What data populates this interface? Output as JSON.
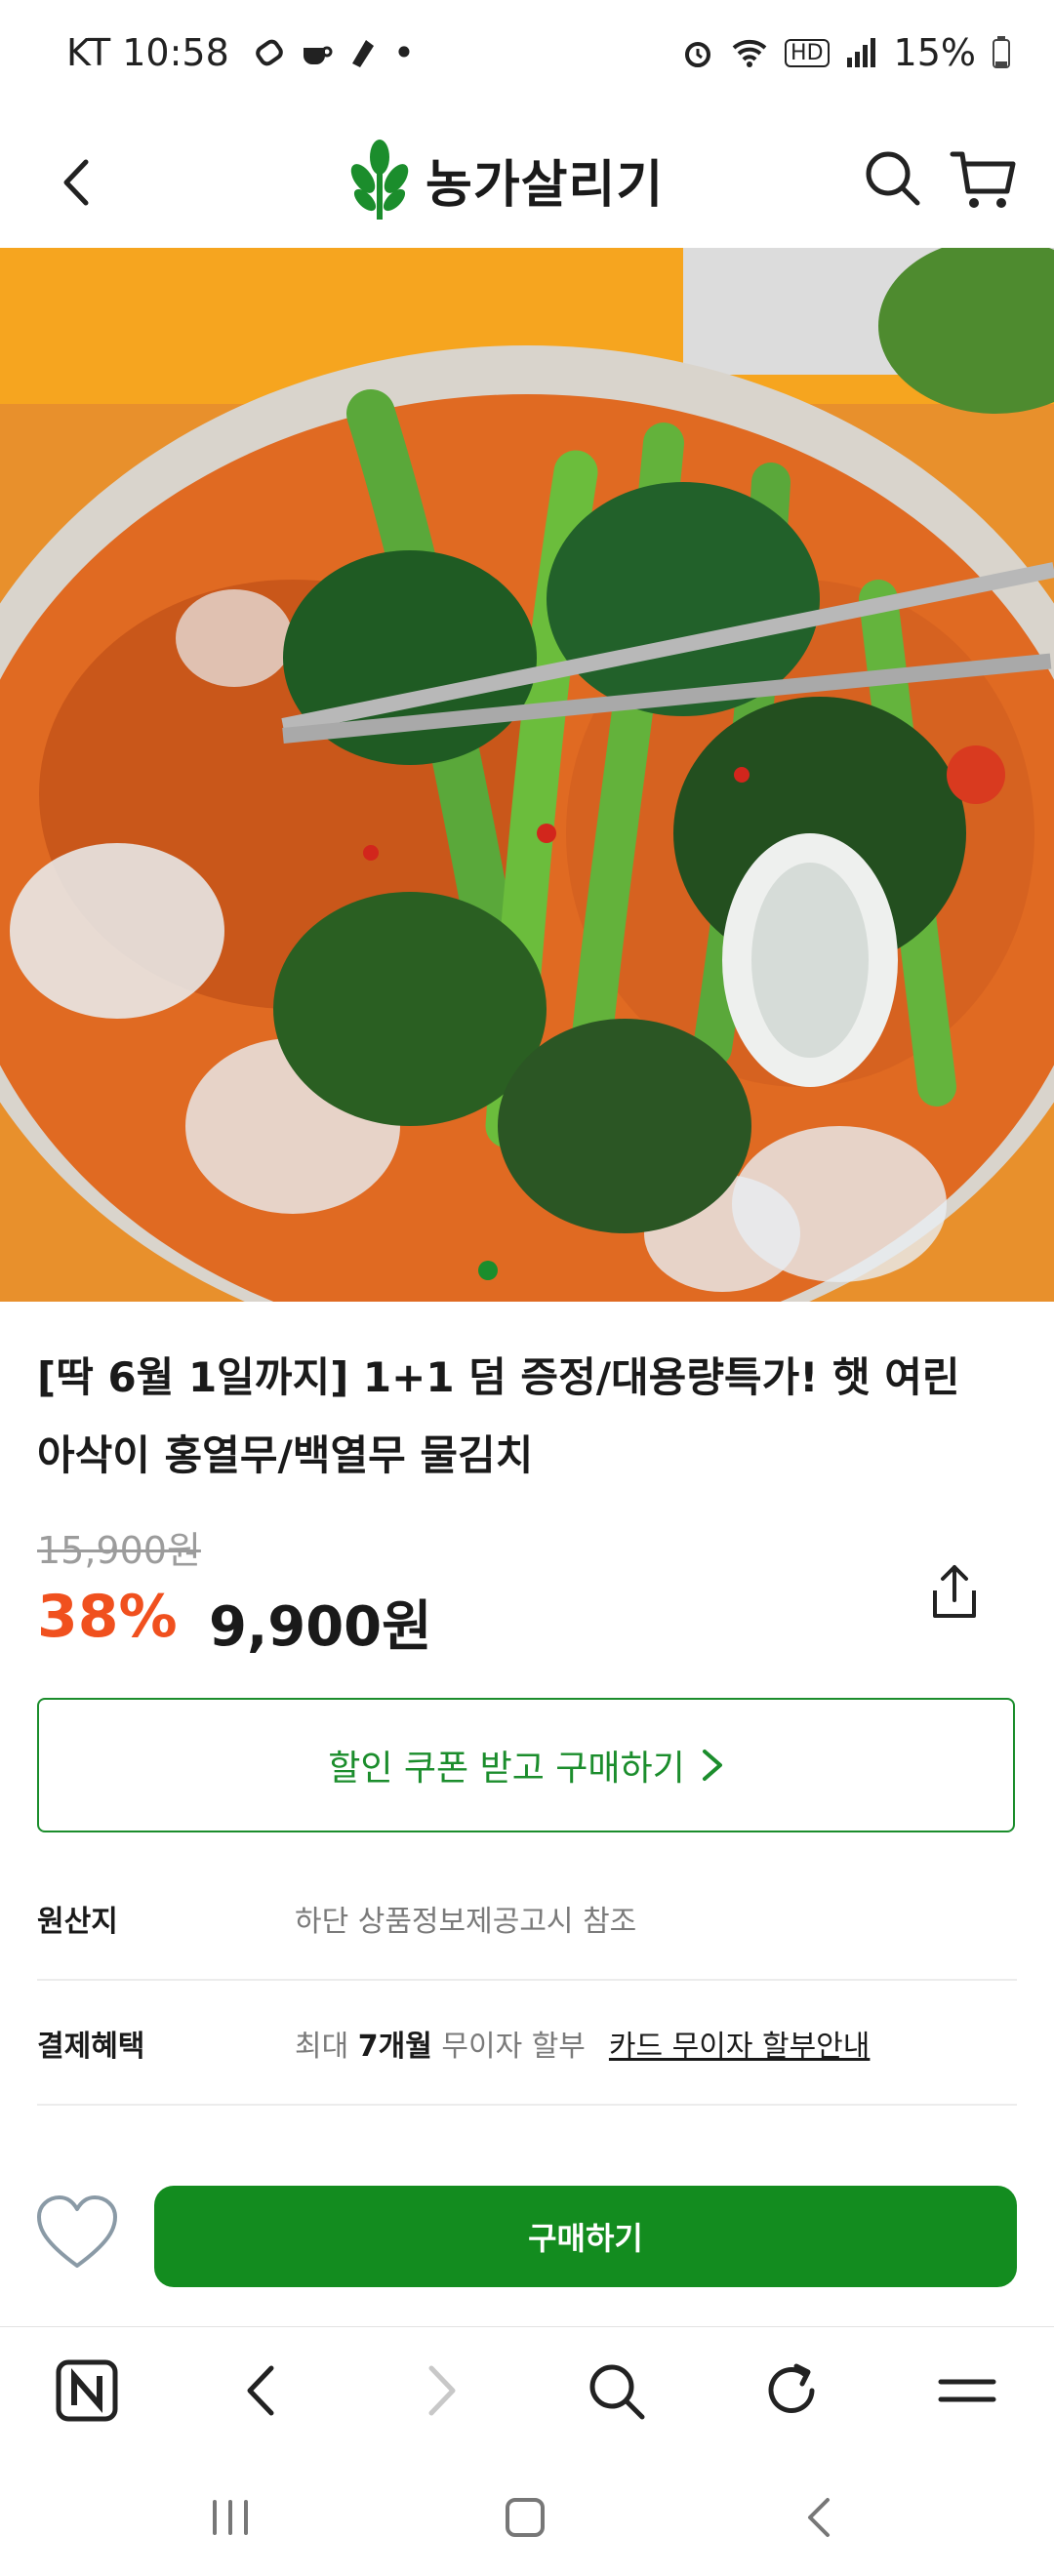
{
  "status_bar": {
    "carrier_time": "KT 10:58",
    "dot": "•",
    "hd_label": "HD",
    "battery": "15%",
    "icons": [
      "phone-link-icon",
      "coffee-icon",
      "note-icon",
      "alarm-icon",
      "wifi-icon",
      "hd-icon",
      "signal-icon",
      "battery-icon"
    ]
  },
  "header": {
    "brand_name": "농가살리기",
    "back_icon": "back-arrow-icon",
    "search_icon": "search-icon",
    "cart_icon": "cart-icon",
    "brand_color": "#1b8d2c"
  },
  "hero": {
    "carousel_dots": 1,
    "active_dot_color": "#1b8d2c"
  },
  "product": {
    "title_line1": "[딱 6월 1일까지] 1+1 덤 증정/대용량특가! 햇 여린",
    "title_line2": "아삭이 홍열무/백열무 물김치",
    "original_price": "15,900원",
    "discount": "38%",
    "price": "9,900원",
    "discount_color": "#f0501e",
    "share_icon": "share-icon"
  },
  "coupon": {
    "label": "할인 쿠폰 받고 구매하기",
    "chevron": "›"
  },
  "info": {
    "origin_label": "원산지",
    "origin_value": "하단 상품정보제공고시 참조",
    "payment_label": "결제혜택",
    "payment_prefix": "최대 ",
    "payment_bold": "7개월",
    "payment_suffix": " 무이자 할부",
    "payment_link": "카드 무이자 할부안내"
  },
  "buy_bar": {
    "buy_label": "구매하기",
    "buy_color": "#138c1f",
    "wish_icon": "heart-icon"
  },
  "browser_toolbar": {
    "items": [
      "naver-n-icon",
      "back-icon",
      "forward-icon",
      "search-icon",
      "refresh-icon",
      "menu-icon"
    ]
  },
  "system_nav": {
    "items": [
      "recent-apps-icon",
      "home-icon",
      "system-back-icon"
    ]
  }
}
